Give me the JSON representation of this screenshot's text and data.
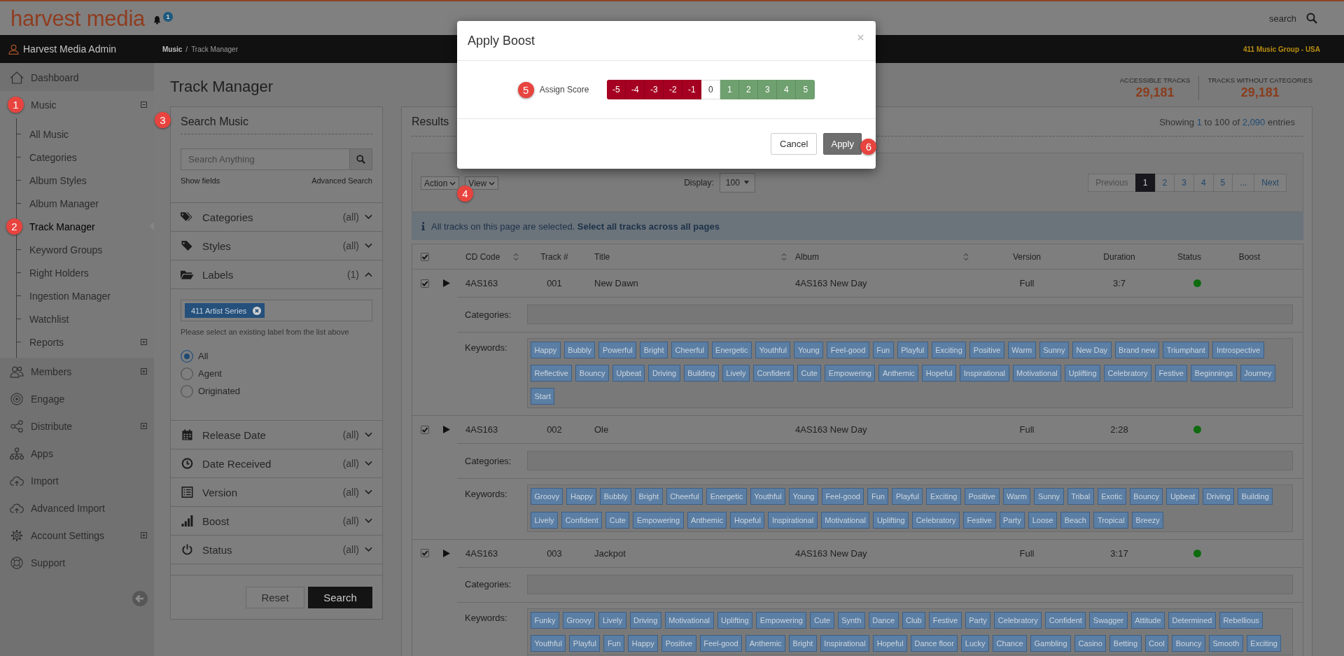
{
  "header": {
    "logo": "harvest media",
    "notification_count": "1",
    "search_label": "search"
  },
  "top_bar": {
    "user": "Harvest Media Admin",
    "breadcrumb": [
      {
        "label": "Music"
      },
      {
        "label": "Track Manager"
      }
    ],
    "breadcrumb_separator": "/",
    "account": "411 Music Group - USA"
  },
  "sidebar": {
    "items": [
      {
        "label": "Dashboard",
        "kind": "link",
        "selected": false
      },
      {
        "label": "Music",
        "kind": "group",
        "expanded": true,
        "selected": false,
        "annotation": "1",
        "children": [
          {
            "label": "All Music",
            "kind": "link",
            "selected": false
          },
          {
            "label": "Categories",
            "kind": "link",
            "selected": false
          },
          {
            "label": "Album Styles",
            "kind": "link",
            "selected": false
          },
          {
            "label": "Album Manager",
            "kind": "link",
            "selected": false
          },
          {
            "label": "Track Manager",
            "kind": "link",
            "selected": true,
            "annotation": "2"
          },
          {
            "label": "Keyword Groups",
            "kind": "link",
            "selected": false
          },
          {
            "label": "Right Holders",
            "kind": "link",
            "selected": false
          },
          {
            "label": "Ingestion Manager",
            "kind": "link",
            "selected": false
          },
          {
            "label": "Watchlist",
            "kind": "link",
            "selected": false
          },
          {
            "label": "Reports",
            "kind": "group",
            "expanded": false,
            "selected": false
          }
        ]
      },
      {
        "label": "Members",
        "kind": "group",
        "expanded": false,
        "selected": false
      },
      {
        "label": "Engage",
        "kind": "link",
        "selected": false
      },
      {
        "label": "Distribute",
        "kind": "group",
        "expanded": false,
        "selected": false
      },
      {
        "label": "Apps",
        "kind": "link",
        "selected": false
      },
      {
        "label": "Import",
        "kind": "link",
        "selected": false
      },
      {
        "label": "Advanced Import",
        "kind": "link",
        "selected": false
      },
      {
        "label": "Account Settings",
        "kind": "group",
        "expanded": false,
        "selected": false
      },
      {
        "label": "Support",
        "kind": "link",
        "selected": false
      }
    ]
  },
  "page_title": "Track Manager",
  "stats": [
    {
      "label": "ACCESSIBLE TRACKS",
      "value": "29,181"
    },
    {
      "label": "TRACKS WITHOUT CATEGORIES",
      "value": "29,181"
    }
  ],
  "search_panel": {
    "title": "Search Music",
    "annotation": "3",
    "search": {
      "placeholder": "Search Anything"
    },
    "show_fields": "Show fields",
    "advanced_search": "Advanced Search",
    "filters": [
      {
        "label": "Categories",
        "count": "(all)",
        "expanded": false
      },
      {
        "label": "Styles",
        "count": "(all)",
        "expanded": false
      },
      {
        "label": "Labels",
        "count": "(1)",
        "expanded": true,
        "tags": [
          "411 Artist Series"
        ],
        "hint": "Please select an existing label from the list above",
        "options": [
          {
            "label": "All",
            "selected": true
          },
          {
            "label": "Agent",
            "selected": false
          },
          {
            "label": "Originated",
            "selected": false
          }
        ]
      },
      {
        "label": "Release Date",
        "count": "(all)",
        "expanded": false
      },
      {
        "label": "Date Received",
        "count": "(all)",
        "expanded": false
      },
      {
        "label": "Version",
        "count": "(all)",
        "expanded": false
      },
      {
        "label": "Boost",
        "count": "(all)",
        "expanded": false
      },
      {
        "label": "Status",
        "count": "(all)",
        "expanded": false
      }
    ],
    "buttons": [
      {
        "label": "Reset",
        "kind": "secondary"
      },
      {
        "label": "Search",
        "kind": "primary"
      }
    ]
  },
  "results": {
    "title": "Results",
    "summary": [
      {
        "text": "Showing",
        "kind": "plain"
      },
      {
        "text": "1",
        "kind": "highlight"
      },
      {
        "text": "to",
        "kind": "plain"
      },
      {
        "text": "100",
        "kind": "plain"
      },
      {
        "text": "of",
        "kind": "plain"
      },
      {
        "text": "2,090",
        "kind": "highlight"
      },
      {
        "text": "entries",
        "kind": "plain"
      }
    ],
    "toolbar": {
      "action": {
        "label": "Action",
        "annotation": "4"
      },
      "view": {
        "label": "View"
      },
      "display_label": "Display:",
      "display_value": "100",
      "pagination": [
        {
          "label": "Previous",
          "selected": false,
          "disabled": true
        },
        {
          "label": "1",
          "selected": true,
          "disabled": false
        },
        {
          "label": "2",
          "selected": false,
          "disabled": false
        },
        {
          "label": "3",
          "selected": false,
          "disabled": false
        },
        {
          "label": "4",
          "selected": false,
          "disabled": false
        },
        {
          "label": "5",
          "selected": false,
          "disabled": false
        },
        {
          "label": "...",
          "selected": false,
          "disabled": false
        },
        {
          "label": "Next",
          "selected": false,
          "disabled": false
        }
      ]
    },
    "notice": "All tracks on this page are selected. **Select all tracks across all pages**",
    "table": {
      "select_all": {
        "checked": true
      },
      "columns": [
        {
          "label": "CD Code",
          "sortable": true
        },
        {
          "label": "Track #",
          "sortable": false
        },
        {
          "label": "Title",
          "sortable": true
        },
        {
          "label": "Album",
          "sortable": true
        },
        {
          "label": "Version",
          "sortable": false
        },
        {
          "label": "Duration",
          "sortable": false
        },
        {
          "label": "Status",
          "sortable": false
        },
        {
          "label": "Boost",
          "sortable": false
        }
      ],
      "rows": [
        {
          "checked": true,
          "cells": [
            "4AS163",
            "001",
            "New Dawn",
            "4AS163 New Day",
            "Full",
            "3:7"
          ],
          "status": {
            "color": "#0e6b0e"
          },
          "categories_label": "Categories:",
          "keywords_label": "Keywords:",
          "keywords": [
            "Happy",
            "Bubbly",
            "Powerful",
            "Bright",
            "Cheerful",
            "Energetic",
            "Youthful",
            "Young",
            "Feel-good",
            "Fun",
            "Playful",
            "Exciting",
            "Positive",
            "Warm",
            "Sunny",
            "New Day",
            "Brand new",
            "Triumphant",
            "Introspective",
            "Reflective",
            "Bouncy",
            "Upbeat",
            "Driving",
            "Building",
            "Lively",
            "Confident",
            "Cute",
            "Empowering",
            "Anthemic",
            "Hopeful",
            "Inspirational",
            "Motivational",
            "Uplifting",
            "Celebratory",
            "Festive",
            "Beginnings",
            "Journey",
            "Start"
          ]
        },
        {
          "checked": true,
          "cells": [
            "4AS163",
            "002",
            "Ole",
            "4AS163 New Day",
            "Full",
            "2:28"
          ],
          "status": {
            "color": "#0e6b0e"
          },
          "categories_label": "Categories:",
          "keywords_label": "Keywords:",
          "keywords": [
            "Groovy",
            "Happy",
            "Bubbly",
            "Bright",
            "Cheerful",
            "Energetic",
            "Youthful",
            "Young",
            "Feel-good",
            "Fun",
            "Playful",
            "Exciting",
            "Positive",
            "Warm",
            "Sunny",
            "Tribal",
            "Exotic",
            "Bouncy",
            "Upbeat",
            "Driving",
            "Building",
            "Lively",
            "Confident",
            "Cute",
            "Empowering",
            "Anthemic",
            "Hopeful",
            "Inspirational",
            "Motivational",
            "Uplifting",
            "Celebratory",
            "Festive",
            "Party",
            "Loose",
            "Beach",
            "Tropical",
            "Breezy"
          ]
        },
        {
          "checked": true,
          "cells": [
            "4AS163",
            "003",
            "Jackpot",
            "4AS163 New Day",
            "Full",
            "3:17"
          ],
          "status": {
            "color": "#0e6b0e"
          },
          "categories_label": "Categories:",
          "keywords_label": "Keywords:",
          "keywords": [
            "Funky",
            "Groovy",
            "Lively",
            "Driving",
            "Motivational",
            "Uplifting",
            "Empowering",
            "Cute",
            "Synth",
            "Dance",
            "Club",
            "Festive",
            "Party",
            "Celebratory",
            "Confident",
            "Swagger",
            "Attitude",
            "Determined",
            "Rebellious",
            "Youthful",
            "Playful",
            "Fun",
            "Happy",
            "Positive",
            "Feel-good",
            "Anthemic",
            "Bright",
            "Inspirational",
            "Hopeful",
            "Dance floor",
            "Lucky",
            "Chance",
            "Gambling",
            "Casino",
            "Betting",
            "Cool",
            "Bouncy",
            "Smooth",
            "Exciting"
          ]
        }
      ]
    }
  },
  "modal": {
    "title": "Apply Boost",
    "score_label": "Assign Score",
    "annotation": "5",
    "scores": [
      {
        "label": "-5",
        "color": "#a50021",
        "selected": false
      },
      {
        "label": "-4",
        "color": "#a50021",
        "selected": false
      },
      {
        "label": "-3",
        "color": "#a50021",
        "selected": false
      },
      {
        "label": "-2",
        "color": "#a50021",
        "selected": false
      },
      {
        "label": "-1",
        "color": "#a50021",
        "selected": false
      },
      {
        "label": "0",
        "color": "#ffffff",
        "selected": false
      },
      {
        "label": "1",
        "color": "#6fa06f",
        "selected": false
      },
      {
        "label": "2",
        "color": "#6fa06f",
        "selected": false
      },
      {
        "label": "3",
        "color": "#6fa06f",
        "selected": false
      },
      {
        "label": "4",
        "color": "#6fa06f",
        "selected": false
      },
      {
        "label": "5",
        "color": "#6fa06f",
        "selected": false
      }
    ],
    "buttons": [
      {
        "label": "Cancel",
        "kind": "secondary"
      },
      {
        "label": "Apply",
        "kind": "primary",
        "annotation": "6"
      }
    ]
  }
}
